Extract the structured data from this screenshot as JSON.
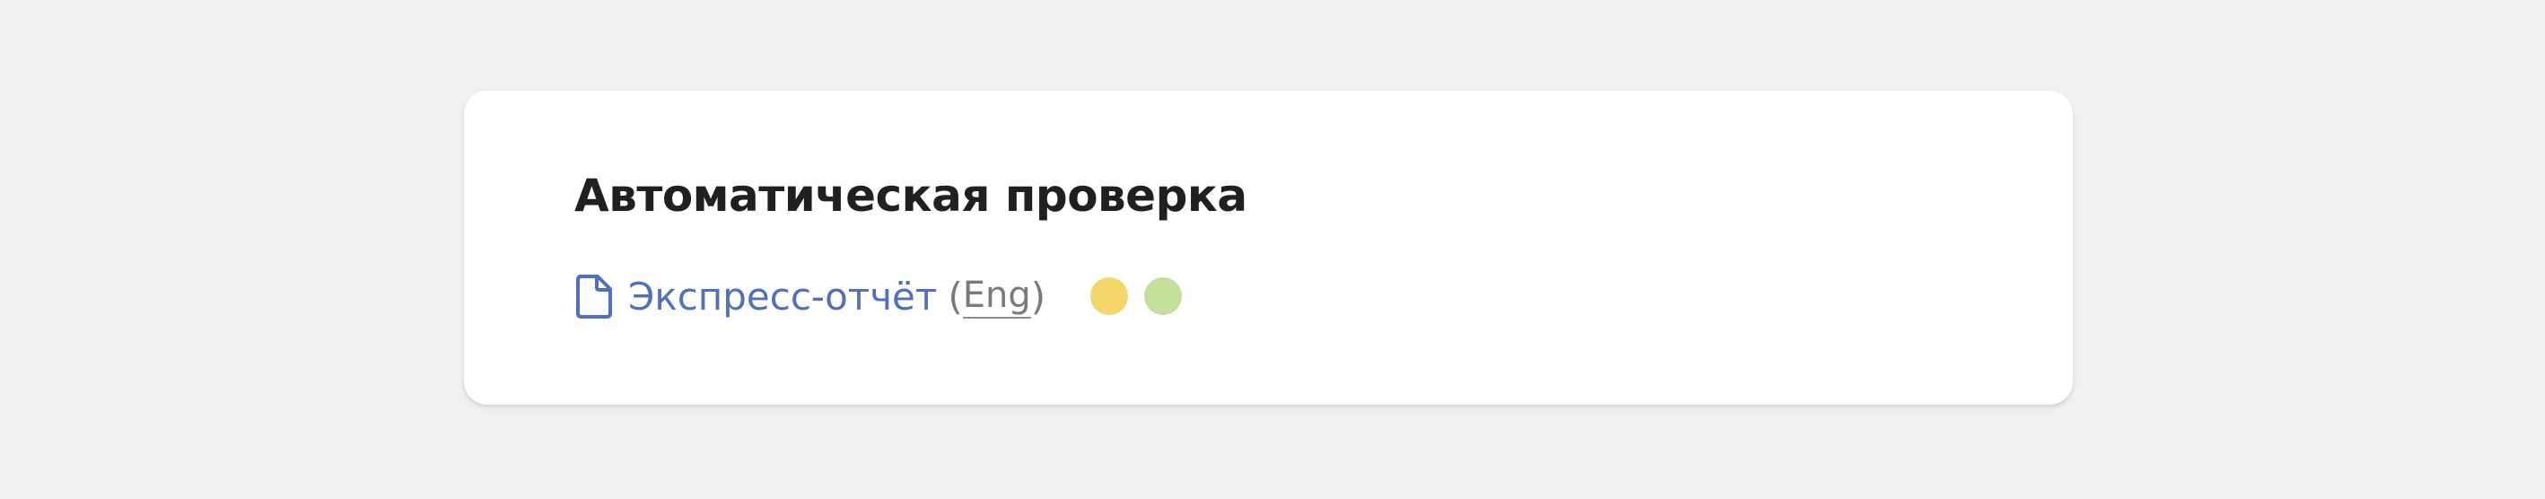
{
  "check": {
    "title": "Автоматическая проверка",
    "report": {
      "icon": "document-icon",
      "link_label": "Экспресс-отчёт",
      "open_paren": "(",
      "lang_label": "Eng",
      "close_paren": ")"
    },
    "status_indicators": [
      {
        "name": "yellow",
        "color": "#f5d66b"
      },
      {
        "name": "green",
        "color": "#c3e09a"
      }
    ]
  },
  "colors": {
    "background": "#f0f0f0",
    "card": "#ffffff",
    "title": "#202020",
    "link": "#4f6fbf",
    "muted": "#7a7a7a"
  }
}
